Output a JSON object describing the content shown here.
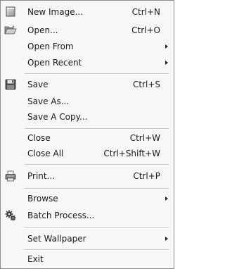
{
  "menu": {
    "items": [
      {
        "label": "New Image...",
        "shortcut": "Ctrl+N",
        "icon": "new-image-icon"
      },
      {
        "label": "Open...",
        "shortcut": "Ctrl+O",
        "icon": "folder-open-icon"
      },
      {
        "label": "Open From",
        "submenu": true
      },
      {
        "label": "Open Recent",
        "submenu": true
      },
      {
        "label": "Save",
        "shortcut": "Ctrl+S",
        "icon": "floppy-disk-icon"
      },
      {
        "label": "Save As..."
      },
      {
        "label": "Save A Copy..."
      },
      {
        "label": "Close",
        "shortcut": "Ctrl+W"
      },
      {
        "label": "Close All",
        "shortcut": "Ctrl+Shift+W"
      },
      {
        "label": "Print...",
        "shortcut": "Ctrl+P",
        "icon": "printer-icon"
      },
      {
        "label": "Browse",
        "submenu": true
      },
      {
        "label": "Batch Process...",
        "icon": "gears-icon"
      },
      {
        "label": "Set Wallpaper",
        "submenu": true
      },
      {
        "label": "Exit"
      }
    ]
  }
}
